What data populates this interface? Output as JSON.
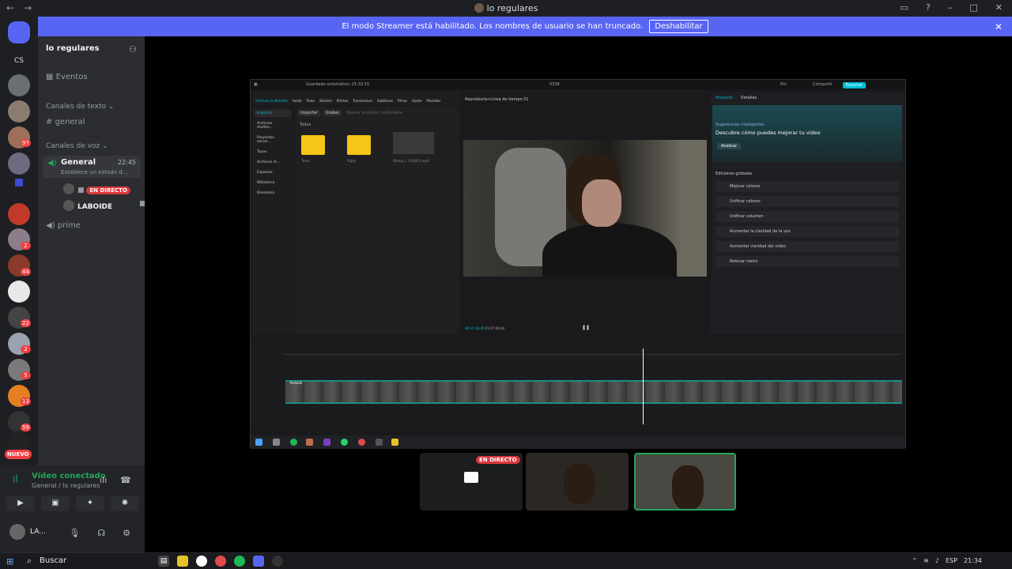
{
  "window": {
    "title": "lo regulares"
  },
  "banner": {
    "text": "El modo Streamer está habilitado. Los nombres de usuario se han truncado.",
    "button": "Deshabilitar"
  },
  "server": {
    "name": "lo regulares"
  },
  "channels": {
    "events": "Eventos",
    "text_category": "Canales de texto",
    "text_channels": [
      "general"
    ],
    "voice_category": "Canales de voz",
    "voice_channel": {
      "name": "General",
      "time": "22:45",
      "status": "Establece un estado d..."
    },
    "voice_users": [
      {
        "name": "",
        "live": "EN DIRECTO"
      },
      {
        "name": "LABOIDE"
      }
    ],
    "other_voice": "prime"
  },
  "server_badges": [
    "97",
    "2",
    "44",
    "22",
    "2",
    "5",
    "13",
    "59"
  ],
  "server_initials": "CS",
  "nuevo": "NUEVO",
  "voice_panel": {
    "status": "Vídeo conectado",
    "location": "General / lo regulares",
    "username": "LA..."
  },
  "stage": {
    "tile_live": "EN DIRECTO"
  },
  "capcut": {
    "autosave": "Guardado automático: 21:32:15",
    "project": "0328",
    "pro": "Pro",
    "share": "Compartir",
    "export": "Exportar",
    "toolbar": [
      "Archivos multimedia",
      "Audio",
      "Texto",
      "Stickers",
      "Efectos",
      "Transiciones",
      "Subtítulos",
      "Filtros",
      "Ajuste",
      "Plantillas"
    ],
    "left_nav": [
      "Importar",
      "Archivos multim...",
      "Proyectos secun...",
      "Tuyos",
      "Archivos m...",
      "Espacios",
      "Biblioteca",
      "Dreamina"
    ],
    "media_import": "Importar",
    "media_record": "Grabar",
    "media_search": "Buscar archivos multimedia",
    "media_all": "Todos",
    "media_items": [
      "Toma",
      "Rigby",
      "Stemp_l...05d401.mp4"
    ],
    "preview_label": "Reproductor-Línea de tiempo 01",
    "timecode_current": "00:17:16:26",
    "timecode_total": "01:07:06:44",
    "tabs": [
      "Proyecto",
      "Detalles"
    ],
    "smart_tag": "Sugerencias inteligentes",
    "smart_title": "Descubre cómo puedes mejorar tu video",
    "analyze": "Analizar",
    "global_edits": "Ediciones globales",
    "options": [
      "Mejorar colores",
      "Unificar colores",
      "Unificar volumen",
      "Aumentar la claridad de la voz",
      "Aumentar claridad del vídeo",
      "Retocar rostro"
    ],
    "track_label": "Portada"
  },
  "taskbar": {
    "search": "Buscar",
    "lang": "ESP",
    "time": "21:34"
  }
}
